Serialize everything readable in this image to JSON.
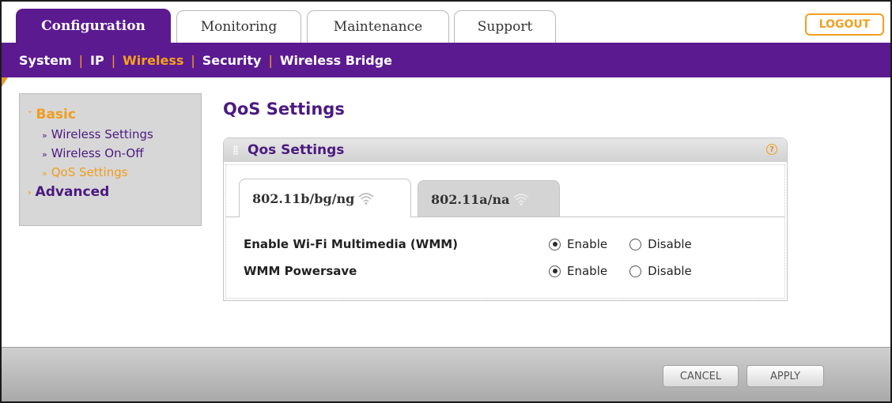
{
  "top_tabs": [
    "Configuration",
    "Monitoring",
    "Maintenance",
    "Support"
  ],
  "active_top_tab": "Configuration",
  "logout_label": "LOGOUT",
  "subnav": [
    "System",
    "IP",
    "Wireless",
    "Security",
    "Wireless Bridge"
  ],
  "active_subnav": "Wireless",
  "left_menu": {
    "basic_label": "Basic",
    "basic_items": [
      "Wireless Settings",
      "Wireless On-Off",
      "QoS Settings"
    ],
    "active_item": "QoS Settings",
    "advanced_label": "Advanced"
  },
  "page_title": "QoS Settings",
  "panel_title": "Qos Settings",
  "help_icon": "?",
  "radio_tabs": [
    "802.11b/bg/ng",
    "802.11a/na"
  ],
  "active_radio_tab": "802.11b/bg/ng",
  "settings": [
    {
      "label": "Enable Wi-Fi Multimedia (WMM)",
      "options": [
        "Enable",
        "Disable"
      ],
      "selected": "Enable"
    },
    {
      "label": "WMM Powersave",
      "options": [
        "Enable",
        "Disable"
      ],
      "selected": "Enable"
    }
  ],
  "buttons": {
    "cancel": "CANCEL",
    "apply": "APPLY"
  },
  "colors": {
    "brand_purple": "#5c1a91",
    "accent_orange": "#f5a21c"
  }
}
